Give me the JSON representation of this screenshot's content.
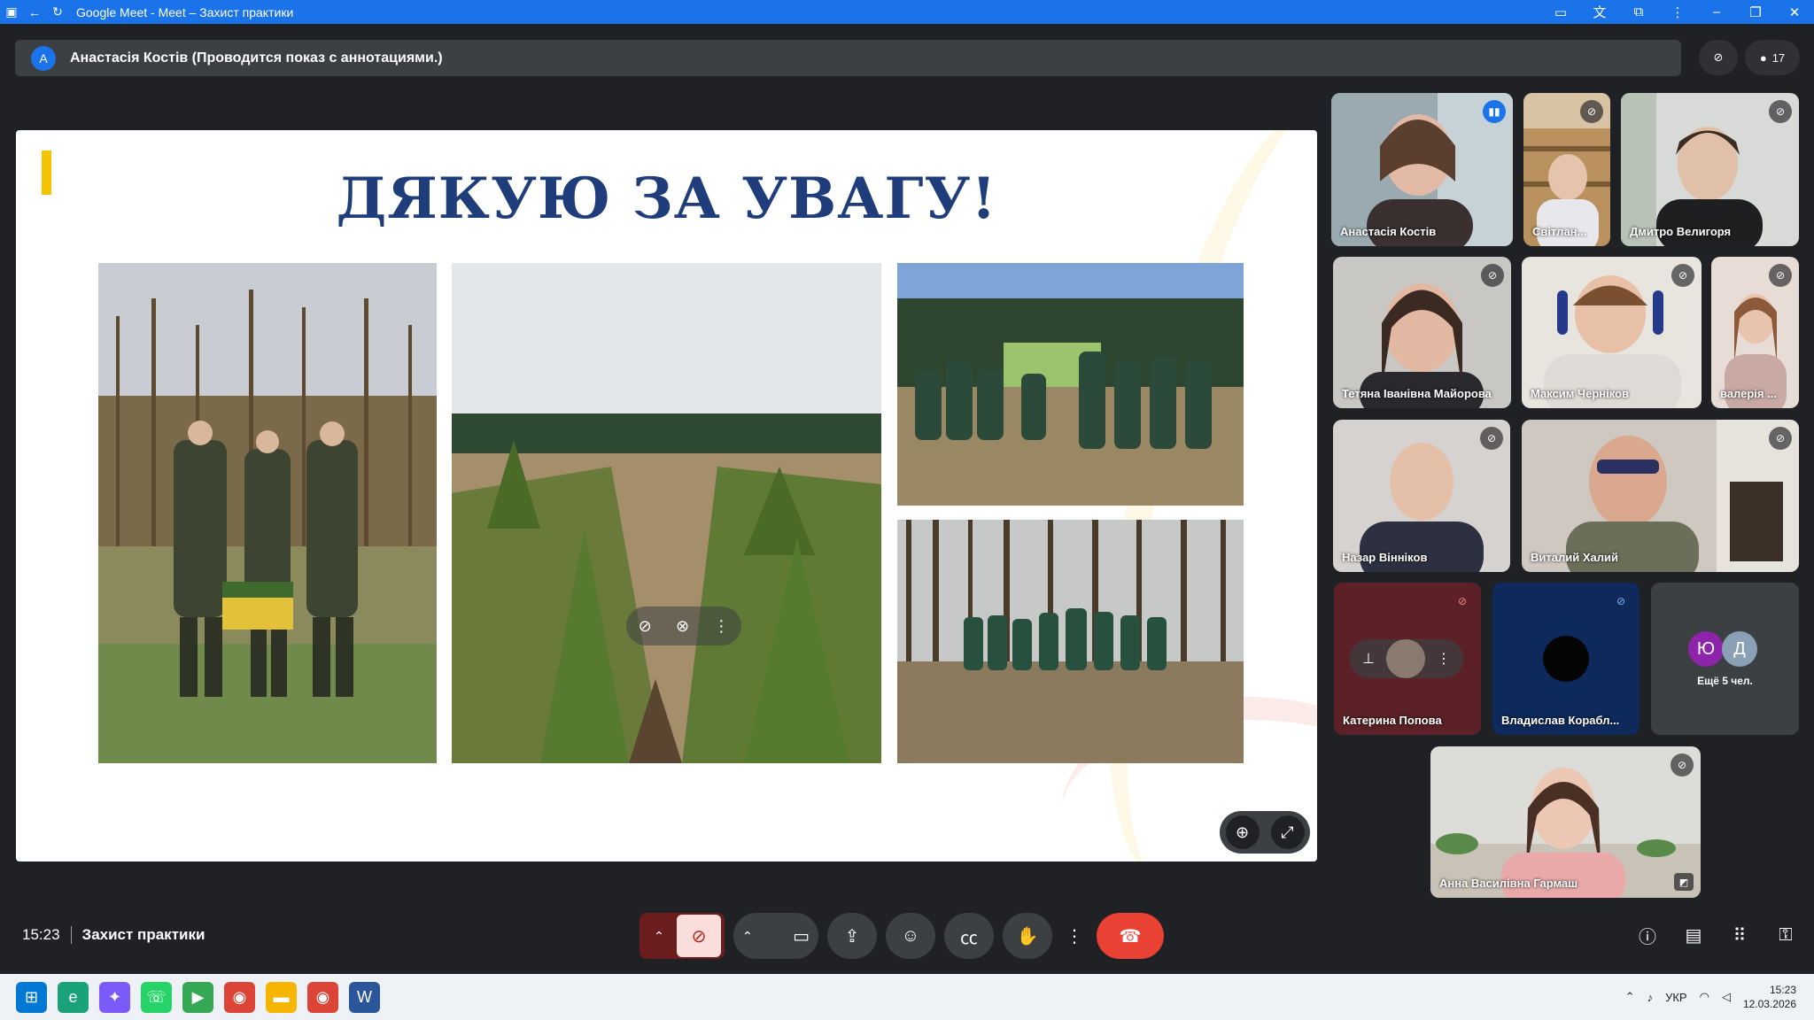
{
  "browser": {
    "title": "Google Meet - Meet – Захист практики"
  },
  "banner": {
    "avatar_letter": "A",
    "text": "Анастасія Костів (Проводится показ с аннотациями.)"
  },
  "participant_count": "17",
  "slide": {
    "heading": "ДЯКУЮ ЗА УВАГУ!"
  },
  "tiles": [
    {
      "name": "Анастасія Костів",
      "mic": "speaking"
    },
    {
      "name": "Світлан...",
      "mic": "muted"
    },
    {
      "name": "Дмитро Велигоря",
      "mic": "muted"
    },
    {
      "name": "Тетяна Іванівна Майорова",
      "mic": "muted"
    },
    {
      "name": "Максим Черніков",
      "mic": "muted"
    },
    {
      "name": "валерія ...",
      "mic": "muted"
    },
    {
      "name": "Назар Вінніков",
      "mic": "muted"
    },
    {
      "name": "Виталий Халий",
      "mic": "muted"
    },
    {
      "name": "Катерина Попова",
      "mic": "muted-red"
    },
    {
      "name": "Владислав Корабл...",
      "mic": "muted-blue"
    },
    {
      "name": "Ещё 5 чел.",
      "avatars": [
        "Ю",
        "Д"
      ]
    },
    {
      "name": "Анна Василівна Гармаш",
      "mic": "muted"
    }
  ],
  "meeting": {
    "time": "15:23",
    "name": "Захист практики"
  },
  "taskbar": {
    "lang": "УКР",
    "time": "15:23",
    "date": "12.03.2026"
  },
  "colors": {
    "meet_bg": "#202124",
    "accent_blue": "#1a73e8",
    "hangup_red": "#ea4335",
    "heading_navy": "#1f3d7a"
  }
}
